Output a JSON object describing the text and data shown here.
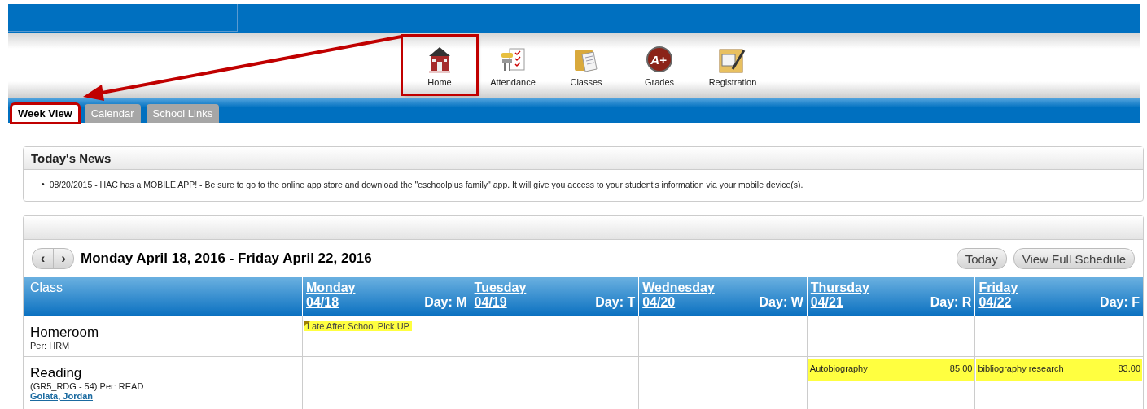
{
  "nav": [
    {
      "label": "Home",
      "highlighted": true
    },
    {
      "label": "Attendance",
      "highlighted": false
    },
    {
      "label": "Classes",
      "highlighted": false
    },
    {
      "label": "Grades",
      "icon_text": "A+",
      "highlighted": false
    },
    {
      "label": "Registration",
      "highlighted": false
    }
  ],
  "tabs": [
    {
      "label": "Week View",
      "selected": true,
      "highlighted": true
    },
    {
      "label": "Calendar",
      "selected": false,
      "highlighted": false
    },
    {
      "label": "School Links",
      "selected": false,
      "highlighted": false
    }
  ],
  "news": {
    "title": "Today's News",
    "bullet": "•",
    "items": [
      "08/20/2015 - HAC has a MOBILE APP! - Be sure to go to the online app store and download the \"eschoolplus family\" app. It will give you access to your student's information via your mobile device(s)."
    ]
  },
  "week": {
    "range": "Monday April 18, 2016 - Friday April 22, 2016",
    "prev": "‹",
    "next": "›",
    "buttons": [
      "Today",
      "View Full Schedule"
    ],
    "class_header": "Class",
    "days": [
      {
        "name": "Monday",
        "date": "04/18",
        "day": "Day: M"
      },
      {
        "name": "Tuesday",
        "date": "04/19",
        "day": "Day: T"
      },
      {
        "name": "Wednesday",
        "date": "04/20",
        "day": "Day: W"
      },
      {
        "name": "Thursday",
        "date": "04/21",
        "day": "Day: R"
      },
      {
        "name": "Friday",
        "date": "04/22",
        "day": "Day: F"
      }
    ],
    "rows": [
      {
        "name": "Homeroom",
        "details": "Per: HRM",
        "cells": [
          {
            "entries": [
              {
                "kind": "note",
                "text": "Late After School Pick UP"
              }
            ]
          },
          {},
          {},
          {},
          {}
        ]
      },
      {
        "name": "Reading",
        "details": "(GR5_RDG - 54) Per: READ",
        "teacher": "Golata, Jordan",
        "cells": [
          {},
          {},
          {},
          {
            "entries": [
              {
                "kind": "score",
                "text": "Autobiography",
                "score": "85.00"
              }
            ]
          },
          {
            "entries": [
              {
                "kind": "score",
                "text": "bibliography research",
                "score": "83.00"
              }
            ]
          }
        ]
      }
    ]
  }
}
